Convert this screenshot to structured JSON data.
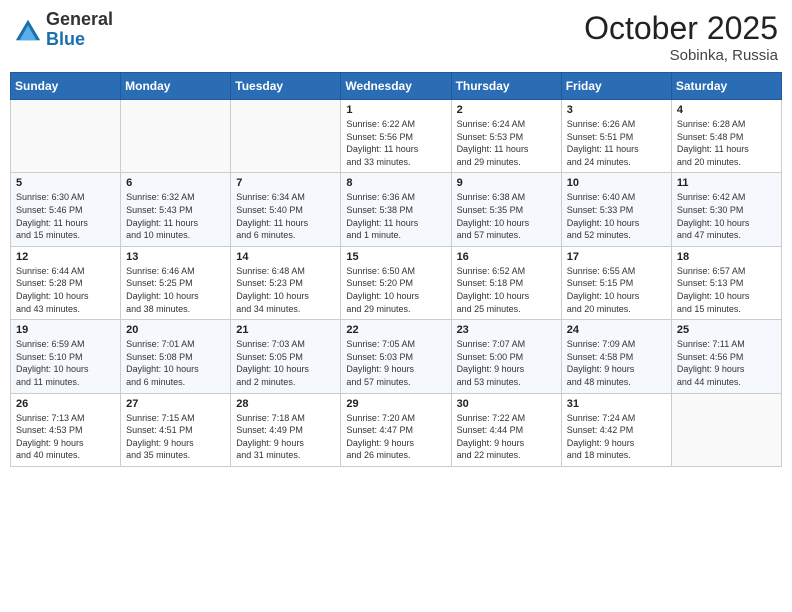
{
  "header": {
    "logo_general": "General",
    "logo_blue": "Blue",
    "month_title": "October 2025",
    "location": "Sobinka, Russia"
  },
  "days_of_week": [
    "Sunday",
    "Monday",
    "Tuesday",
    "Wednesday",
    "Thursday",
    "Friday",
    "Saturday"
  ],
  "weeks": [
    [
      {
        "num": "",
        "info": ""
      },
      {
        "num": "",
        "info": ""
      },
      {
        "num": "",
        "info": ""
      },
      {
        "num": "1",
        "info": "Sunrise: 6:22 AM\nSunset: 5:56 PM\nDaylight: 11 hours\nand 33 minutes."
      },
      {
        "num": "2",
        "info": "Sunrise: 6:24 AM\nSunset: 5:53 PM\nDaylight: 11 hours\nand 29 minutes."
      },
      {
        "num": "3",
        "info": "Sunrise: 6:26 AM\nSunset: 5:51 PM\nDaylight: 11 hours\nand 24 minutes."
      },
      {
        "num": "4",
        "info": "Sunrise: 6:28 AM\nSunset: 5:48 PM\nDaylight: 11 hours\nand 20 minutes."
      }
    ],
    [
      {
        "num": "5",
        "info": "Sunrise: 6:30 AM\nSunset: 5:46 PM\nDaylight: 11 hours\nand 15 minutes."
      },
      {
        "num": "6",
        "info": "Sunrise: 6:32 AM\nSunset: 5:43 PM\nDaylight: 11 hours\nand 10 minutes."
      },
      {
        "num": "7",
        "info": "Sunrise: 6:34 AM\nSunset: 5:40 PM\nDaylight: 11 hours\nand 6 minutes."
      },
      {
        "num": "8",
        "info": "Sunrise: 6:36 AM\nSunset: 5:38 PM\nDaylight: 11 hours\nand 1 minute."
      },
      {
        "num": "9",
        "info": "Sunrise: 6:38 AM\nSunset: 5:35 PM\nDaylight: 10 hours\nand 57 minutes."
      },
      {
        "num": "10",
        "info": "Sunrise: 6:40 AM\nSunset: 5:33 PM\nDaylight: 10 hours\nand 52 minutes."
      },
      {
        "num": "11",
        "info": "Sunrise: 6:42 AM\nSunset: 5:30 PM\nDaylight: 10 hours\nand 47 minutes."
      }
    ],
    [
      {
        "num": "12",
        "info": "Sunrise: 6:44 AM\nSunset: 5:28 PM\nDaylight: 10 hours\nand 43 minutes."
      },
      {
        "num": "13",
        "info": "Sunrise: 6:46 AM\nSunset: 5:25 PM\nDaylight: 10 hours\nand 38 minutes."
      },
      {
        "num": "14",
        "info": "Sunrise: 6:48 AM\nSunset: 5:23 PM\nDaylight: 10 hours\nand 34 minutes."
      },
      {
        "num": "15",
        "info": "Sunrise: 6:50 AM\nSunset: 5:20 PM\nDaylight: 10 hours\nand 29 minutes."
      },
      {
        "num": "16",
        "info": "Sunrise: 6:52 AM\nSunset: 5:18 PM\nDaylight: 10 hours\nand 25 minutes."
      },
      {
        "num": "17",
        "info": "Sunrise: 6:55 AM\nSunset: 5:15 PM\nDaylight: 10 hours\nand 20 minutes."
      },
      {
        "num": "18",
        "info": "Sunrise: 6:57 AM\nSunset: 5:13 PM\nDaylight: 10 hours\nand 15 minutes."
      }
    ],
    [
      {
        "num": "19",
        "info": "Sunrise: 6:59 AM\nSunset: 5:10 PM\nDaylight: 10 hours\nand 11 minutes."
      },
      {
        "num": "20",
        "info": "Sunrise: 7:01 AM\nSunset: 5:08 PM\nDaylight: 10 hours\nand 6 minutes."
      },
      {
        "num": "21",
        "info": "Sunrise: 7:03 AM\nSunset: 5:05 PM\nDaylight: 10 hours\nand 2 minutes."
      },
      {
        "num": "22",
        "info": "Sunrise: 7:05 AM\nSunset: 5:03 PM\nDaylight: 9 hours\nand 57 minutes."
      },
      {
        "num": "23",
        "info": "Sunrise: 7:07 AM\nSunset: 5:00 PM\nDaylight: 9 hours\nand 53 minutes."
      },
      {
        "num": "24",
        "info": "Sunrise: 7:09 AM\nSunset: 4:58 PM\nDaylight: 9 hours\nand 48 minutes."
      },
      {
        "num": "25",
        "info": "Sunrise: 7:11 AM\nSunset: 4:56 PM\nDaylight: 9 hours\nand 44 minutes."
      }
    ],
    [
      {
        "num": "26",
        "info": "Sunrise: 7:13 AM\nSunset: 4:53 PM\nDaylight: 9 hours\nand 40 minutes."
      },
      {
        "num": "27",
        "info": "Sunrise: 7:15 AM\nSunset: 4:51 PM\nDaylight: 9 hours\nand 35 minutes."
      },
      {
        "num": "28",
        "info": "Sunrise: 7:18 AM\nSunset: 4:49 PM\nDaylight: 9 hours\nand 31 minutes."
      },
      {
        "num": "29",
        "info": "Sunrise: 7:20 AM\nSunset: 4:47 PM\nDaylight: 9 hours\nand 26 minutes."
      },
      {
        "num": "30",
        "info": "Sunrise: 7:22 AM\nSunset: 4:44 PM\nDaylight: 9 hours\nand 22 minutes."
      },
      {
        "num": "31",
        "info": "Sunrise: 7:24 AM\nSunset: 4:42 PM\nDaylight: 9 hours\nand 18 minutes."
      },
      {
        "num": "",
        "info": ""
      }
    ]
  ]
}
